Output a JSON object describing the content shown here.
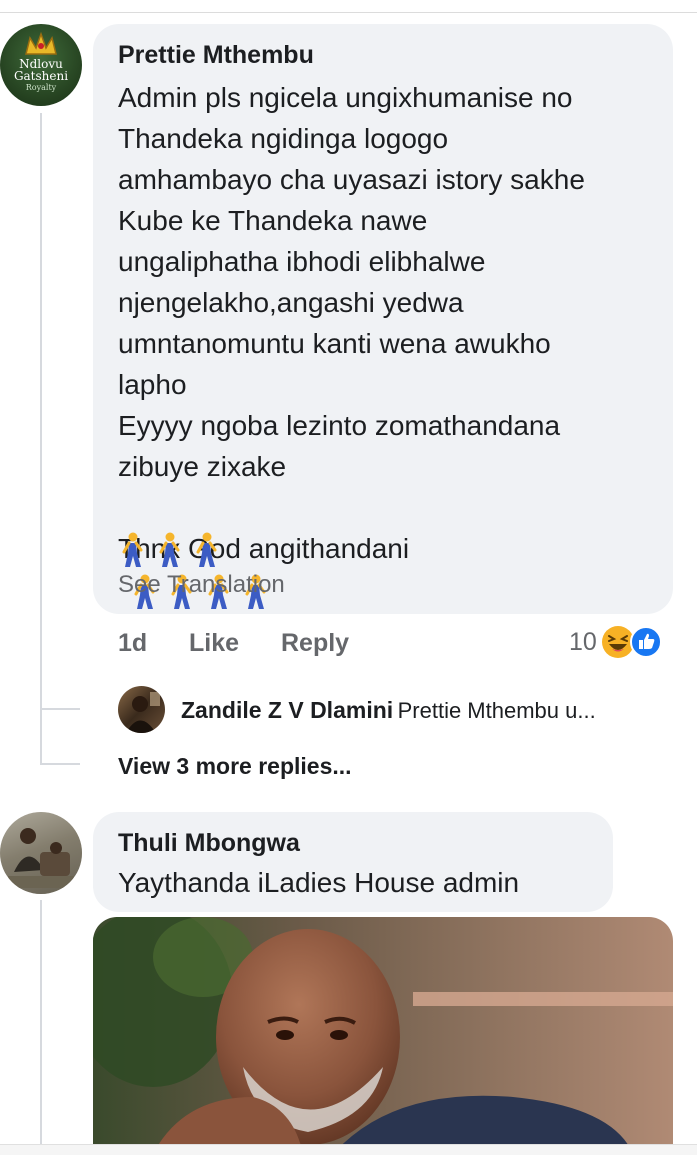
{
  "comment1": {
    "avatar_text": [
      "Ndlovu",
      "Gatsheni",
      "Royalty"
    ],
    "author": "Prettie Mthembu",
    "text": "Admin pls ngicela ungixhumanise no\nThandeka ngidinga logogo\namhambayo cha uyasazi istory sakhe\nKube ke Thandeka nawe\nungaliphatha ibhodi elibhalwe\nnjengelakho,angashi yedwa\numntanomuntu kanti wena awukho\nlapho\nEyyyy ngoba lezinto zomathandana\nzibuye zixake",
    "last_line": "Thnx God angithandani",
    "emoji_icon": "person-walking-icon",
    "see_translation": "See Translation",
    "time": "1d",
    "like": "Like",
    "reply": "Reply",
    "reaction_count": "10",
    "reactions": [
      "laughing-emoji-icon",
      "like-reaction-icon"
    ],
    "reply_preview": {
      "author": "Zandile Z V Dlamini",
      "text": "Prettie Mthembu u..."
    },
    "view_more": "View 3 more replies..."
  },
  "comment2": {
    "author": "Thuli Mbongwa",
    "text": "Yaythanda iLadies House admin"
  },
  "colors": {
    "bubble": "#f0f2f5",
    "secondary_text": "#65676b",
    "like_blue": "#1877f2",
    "haha_yellow": "#f7b125"
  }
}
